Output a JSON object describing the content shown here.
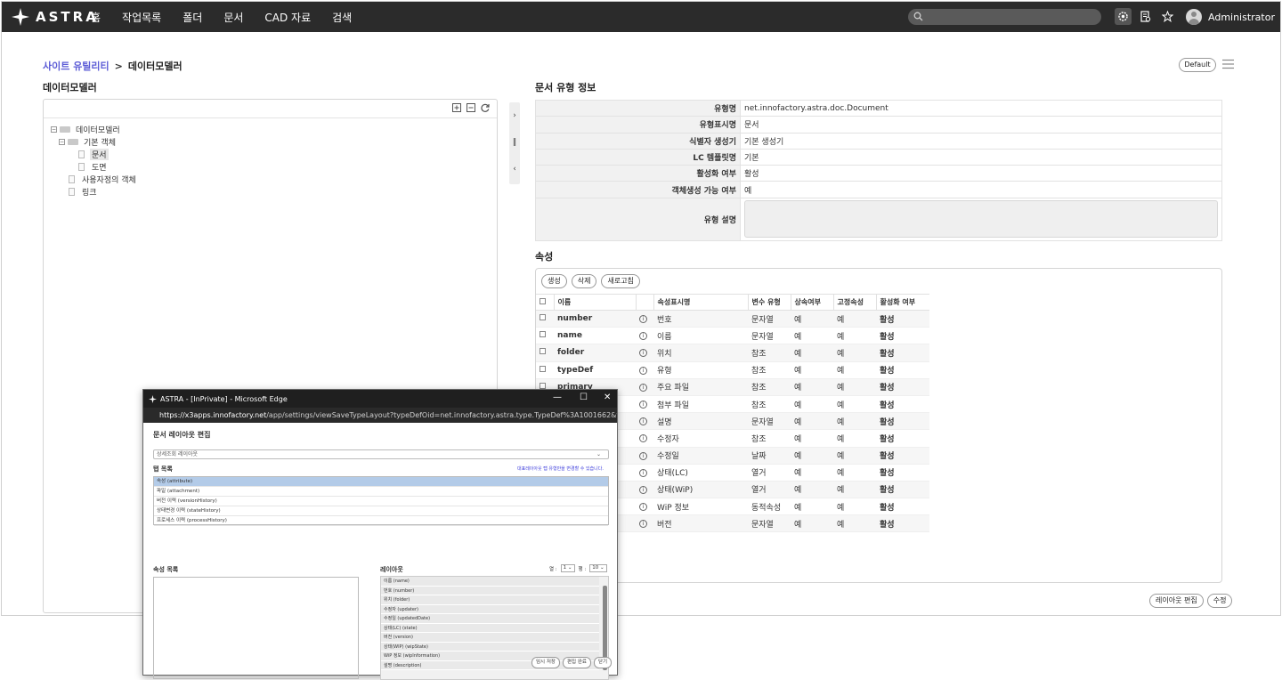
{
  "app": {
    "logo_text": "ASTRA",
    "nav": [
      "홈",
      "작업목록",
      "폴더",
      "문서",
      "CAD 자료",
      "검색"
    ],
    "user_name": "Administrator"
  },
  "breadcrumb": {
    "parent": "사이트 유틸리티",
    "separator": ">",
    "current": "데이터모델러"
  },
  "default_button": "Default",
  "left": {
    "title": "데이터모델러",
    "tree": {
      "root": "데이터모델러",
      "base": "기본 객체",
      "doc": "문서",
      "drawing": "도면",
      "user_obj": "사용자정의 객체",
      "link": "링크"
    }
  },
  "info": {
    "title": "문서 유형 정보",
    "rows": [
      {
        "label": "유형명",
        "value": "net.innofactory.astra.doc.Document"
      },
      {
        "label": "유형표시명",
        "value": "문서"
      },
      {
        "label": "식별자 생성기",
        "value": "기본 생성기"
      },
      {
        "label": "LC 템플릿명",
        "value": "기본"
      },
      {
        "label": "활성화 여부",
        "value": "활성"
      },
      {
        "label": "객체생성 가능 여부",
        "value": "예"
      }
    ],
    "desc_label": "유형 설명"
  },
  "attributes": {
    "title": "속성",
    "buttons": {
      "create": "생성",
      "delete": "삭제",
      "refresh": "새로고침"
    },
    "headers": {
      "name": "이름",
      "display": "속성표시명",
      "var_type": "변수 유형",
      "inherit": "상속여부",
      "fixed": "고정속성",
      "active": "활성화 여부"
    },
    "rows": [
      {
        "name": "number",
        "display": "번호",
        "type": "문자열",
        "inherit": "예",
        "fixed": "예",
        "active": "활성"
      },
      {
        "name": "name",
        "display": "이름",
        "type": "문자열",
        "inherit": "예",
        "fixed": "예",
        "active": "활성"
      },
      {
        "name": "folder",
        "display": "위치",
        "type": "참조",
        "inherit": "예",
        "fixed": "예",
        "active": "활성"
      },
      {
        "name": "typeDef",
        "display": "유형",
        "type": "참조",
        "inherit": "예",
        "fixed": "예",
        "active": "활성"
      },
      {
        "name": "primary",
        "display": "주요 파일",
        "type": "참조",
        "inherit": "예",
        "fixed": "예",
        "active": "활성"
      },
      {
        "name": "",
        "display": "첨부 파일",
        "type": "참조",
        "inherit": "예",
        "fixed": "예",
        "active": "활성"
      },
      {
        "name": "",
        "display": "설명",
        "type": "문자열",
        "inherit": "예",
        "fixed": "예",
        "active": "활성"
      },
      {
        "name": "",
        "display": "수정자",
        "type": "참조",
        "inherit": "예",
        "fixed": "예",
        "active": "활성"
      },
      {
        "name": "",
        "display": "수정일",
        "type": "날짜",
        "inherit": "예",
        "fixed": "예",
        "active": "활성"
      },
      {
        "name": "",
        "display": "상태(LC)",
        "type": "열거",
        "inherit": "예",
        "fixed": "예",
        "active": "활성"
      },
      {
        "name": "",
        "display": "상태(WiP)",
        "type": "열거",
        "inherit": "예",
        "fixed": "예",
        "active": "활성"
      },
      {
        "name": "",
        "display": "WiP 정보",
        "type": "동적속성",
        "inherit": "예",
        "fixed": "예",
        "active": "활성"
      },
      {
        "name": "",
        "display": "버전",
        "type": "문자열",
        "inherit": "예",
        "fixed": "예",
        "active": "활성"
      }
    ]
  },
  "bottom_buttons": {
    "layout_edit": "레이아웃 편집",
    "modify": "수정"
  },
  "popup": {
    "window_title": "ASTRA - [InPrivate] - Microsoft Edge",
    "url_host": "https://x3apps.innofactory.net",
    "url_path": "/app/settings/viewSaveTypeLayout?typeDefOid=net.innofactory.astra.type.TypeDef%3A1001662&tab...",
    "heading": "문서 레이아웃 편집",
    "layout_select": "상세조회 레이아웃",
    "tab_list_label": "탭 목록",
    "note": "대표레이아웃 탭 유형만을 변경할 수 있습니다.",
    "tabs": [
      "속성 (attribute)",
      "파일 (attachment)",
      "버전 이력 (versionHistory)",
      "상태변경 이력 (stateHistory)",
      "프로세스 이력 (processHistory)"
    ],
    "attr_list_label": "속성 목록",
    "layout_label": "레이아웃",
    "row_label": "열 :",
    "row_value": "1",
    "col_label": "행 :",
    "col_value": "10",
    "layout_items": [
      "이름 (name)",
      "번호 (number)",
      "위치 (folder)",
      "수정자 (updater)",
      "수정일 (updatedDate)",
      "상태(LC) (state)",
      "버전 (version)",
      "상태(WIP) (wipState)",
      "WiP 정보 (wipInformation)",
      "설명 (description)"
    ],
    "buttons": {
      "temp_save": "임시 저장",
      "done": "편집 완료",
      "close": "닫기"
    }
  }
}
